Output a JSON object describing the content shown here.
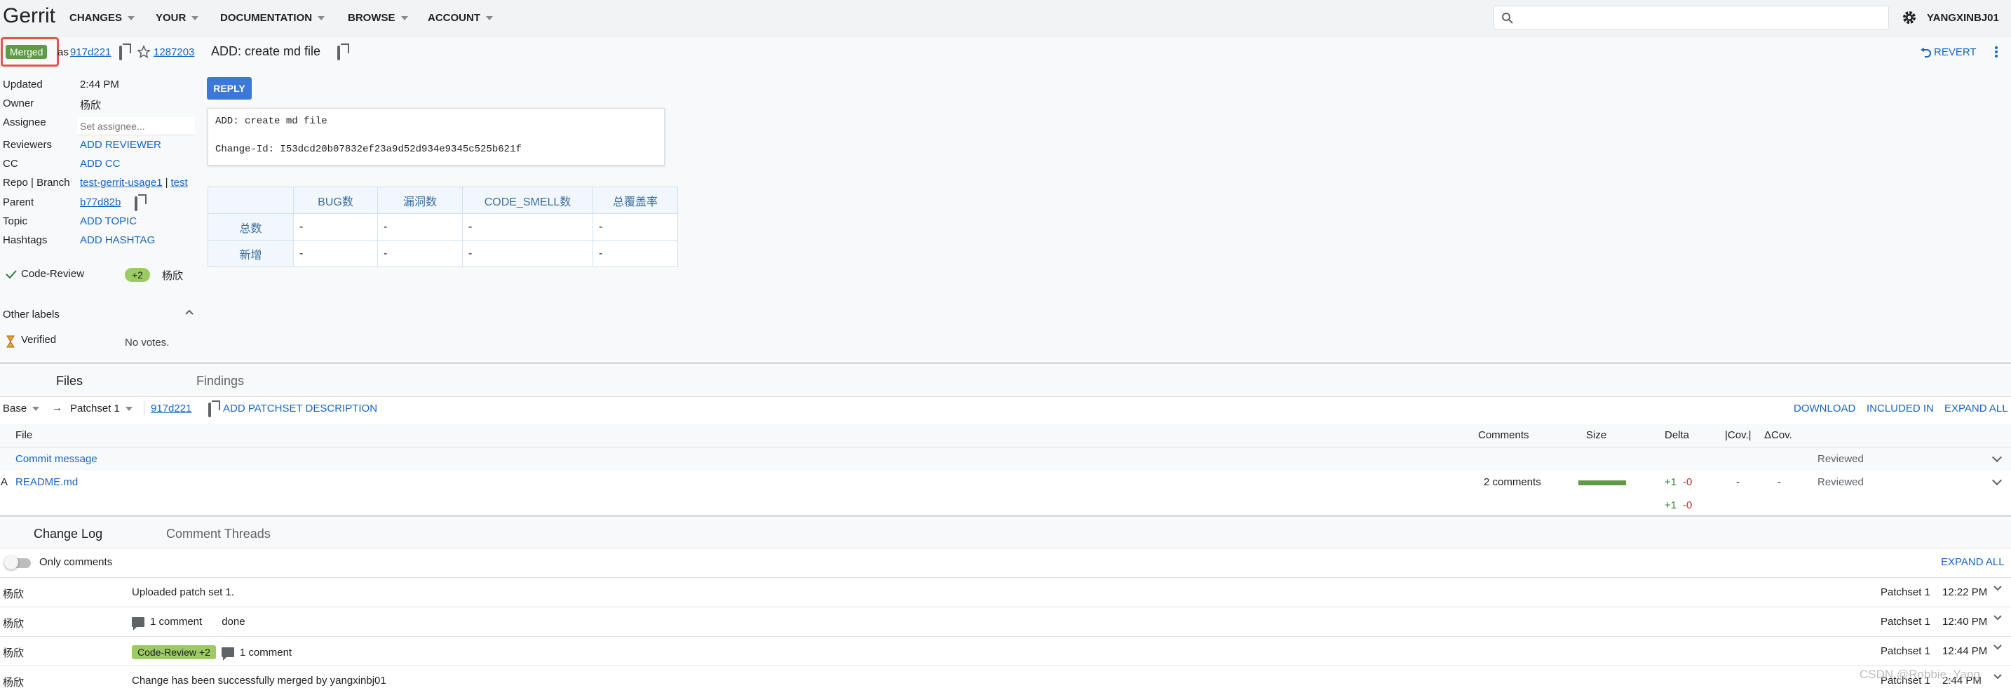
{
  "header": {
    "logo": "Gerrit",
    "nav": [
      "CHANGES",
      "YOUR",
      "DOCUMENTATION",
      "BROWSE",
      "ACCOUNT"
    ],
    "search_value": "",
    "user": "YANGXINBJ01"
  },
  "change": {
    "status": "Merged",
    "as_text": "as",
    "commit_short": "917d221",
    "change_number": "1287203",
    "subject": "ADD: create md file",
    "revert_label": "REVERT"
  },
  "info": {
    "updated_label": "Updated",
    "updated_value": "2:44 PM",
    "owner_label": "Owner",
    "owner_value": "杨欣",
    "assignee_label": "Assignee",
    "assignee_placeholder": "Set assignee...",
    "reviewers_label": "Reviewers",
    "reviewers_value": "ADD REVIEWER",
    "cc_label": "CC",
    "cc_value": "ADD CC",
    "repo_label": "Repo | Branch",
    "repo_value": "test-gerrit-usage1",
    "branch_sep": "|",
    "branch_value": "test",
    "parent_label": "Parent",
    "parent_value": "b77d82b",
    "topic_label": "Topic",
    "topic_value": "ADD TOPIC",
    "hashtags_label": "Hashtags",
    "hashtags_value": "ADD HASHTAG",
    "code_review_label": "Code-Review",
    "code_review_vote": "+2",
    "code_review_voter": "杨欣",
    "other_labels": "Other labels",
    "verified_label": "Verified",
    "verified_value": "No votes."
  },
  "reply_label": "REPLY",
  "commit_message": [
    "ADD: create md file",
    "",
    "Change-Id: I53dcd20b07832ef23a9d52d934e9345c525b621f"
  ],
  "quality_table": {
    "headers": [
      "",
      "BUG数",
      "漏洞数",
      "CODE_SMELL数",
      "总覆盖率"
    ],
    "rows": [
      [
        "总数",
        "-",
        "-",
        "-",
        "-"
      ],
      [
        "新增",
        "-",
        "-",
        "-",
        "-"
      ]
    ]
  },
  "files": {
    "tabs": [
      "Files",
      "Findings"
    ],
    "base": "Base",
    "arrow": "→",
    "patchset": "Patchset 1",
    "patchset_commit": "917d221",
    "add_desc": "ADD PATCHSET DESCRIPTION",
    "actions": [
      "DOWNLOAD",
      "INCLUDED IN",
      "EXPAND ALL"
    ],
    "columns": [
      "File",
      "Comments",
      "Size",
      "Delta",
      "|Cov.|",
      "ΔCov."
    ],
    "rows": [
      {
        "status": "",
        "name": "Commit message",
        "comments": "",
        "plus": "",
        "minus": "",
        "cov": "",
        "dcov": "",
        "reviewed": "Reviewed"
      },
      {
        "status": "A",
        "name": "README.md",
        "comments": "2 comments",
        "plus": "+1",
        "minus": "-0",
        "cov": "-",
        "dcov": "-",
        "reviewed": "Reviewed"
      }
    ],
    "total_plus": "+1",
    "total_minus": "-0"
  },
  "log": {
    "tabs": [
      "Change Log",
      "Comment Threads"
    ],
    "only_comments": "Only comments",
    "expand_all": "EXPAND ALL",
    "rows": [
      {
        "who": "杨欣",
        "tag": "",
        "comment": "",
        "msg": "Uploaded patch set 1.",
        "ps": "Patchset 1",
        "time": "12:22 PM"
      },
      {
        "who": "杨欣",
        "tag": "",
        "comment": "1 comment",
        "msg": "done",
        "ps": "Patchset 1",
        "time": "12:40 PM"
      },
      {
        "who": "杨欣",
        "tag": "Code-Review +2",
        "comment": "1 comment",
        "msg": "",
        "ps": "Patchset 1",
        "time": "12:44 PM"
      },
      {
        "who": "杨欣",
        "tag": "",
        "comment": "",
        "msg": "Change has been successfully merged by yangxinbj01",
        "ps": "Patchset 1",
        "time": "2:44 PM"
      }
    ]
  },
  "watermark": "CSDN @Robbie_Yang",
  "colors": {
    "accent": "#1565c0",
    "merged": "#5f9a47",
    "vote": "#9cca63",
    "reply": "#3c78d8"
  }
}
